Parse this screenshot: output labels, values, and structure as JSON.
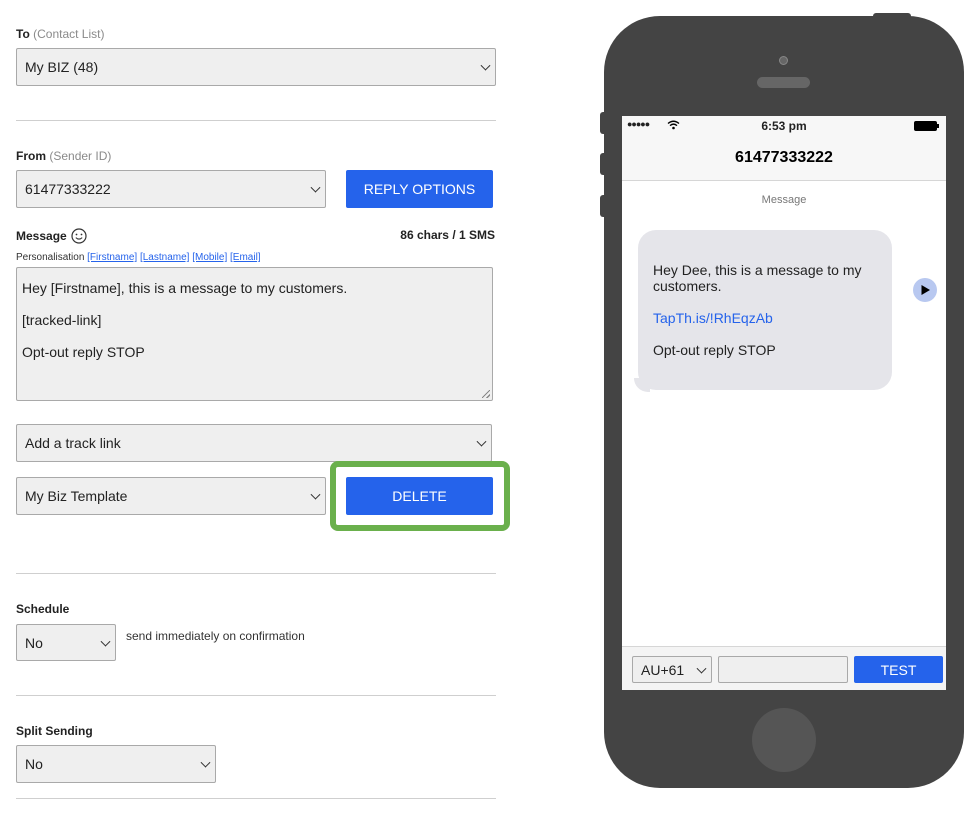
{
  "to": {
    "label": "To",
    "sublabel": "(Contact List)",
    "value": "My BIZ (48)"
  },
  "from": {
    "label": "From",
    "sublabel": "(Sender ID)",
    "value": "61477333222",
    "reply_button": "REPLY OPTIONS"
  },
  "message": {
    "label": "Message",
    "counter": "86 chars / 1 SMS",
    "personalisation_label": "Personalisation",
    "tags": [
      "[Firstname]",
      "[Lastname]",
      "[Mobile]",
      "[Email]"
    ],
    "lines": [
      "Hey [Firstname], this is a message to my customers.",
      "[tracked-link]",
      "Opt-out reply STOP"
    ]
  },
  "track_link": {
    "value": "Add a track link"
  },
  "template": {
    "value": "My Biz Template",
    "delete_button": "DELETE"
  },
  "schedule": {
    "label": "Schedule",
    "value": "No",
    "hint": "send immediately on confirmation"
  },
  "split": {
    "label": "Split Sending",
    "value": "No"
  },
  "phone": {
    "signal": "●●●●●",
    "time": "6:53 pm",
    "contact": "61477333222",
    "message_header": "Message",
    "bubble_lines": [
      "Hey Dee, this is a message to my customers.",
      "TapTh.is/!RhEqzAb",
      "Opt-out reply STOP"
    ],
    "country_code": "AU+61",
    "test_button": "TEST"
  },
  "colors": {
    "accent": "#2563eb",
    "highlight": "#6ab04c",
    "phone_body": "#444444",
    "bubble": "#e5e5ea"
  }
}
